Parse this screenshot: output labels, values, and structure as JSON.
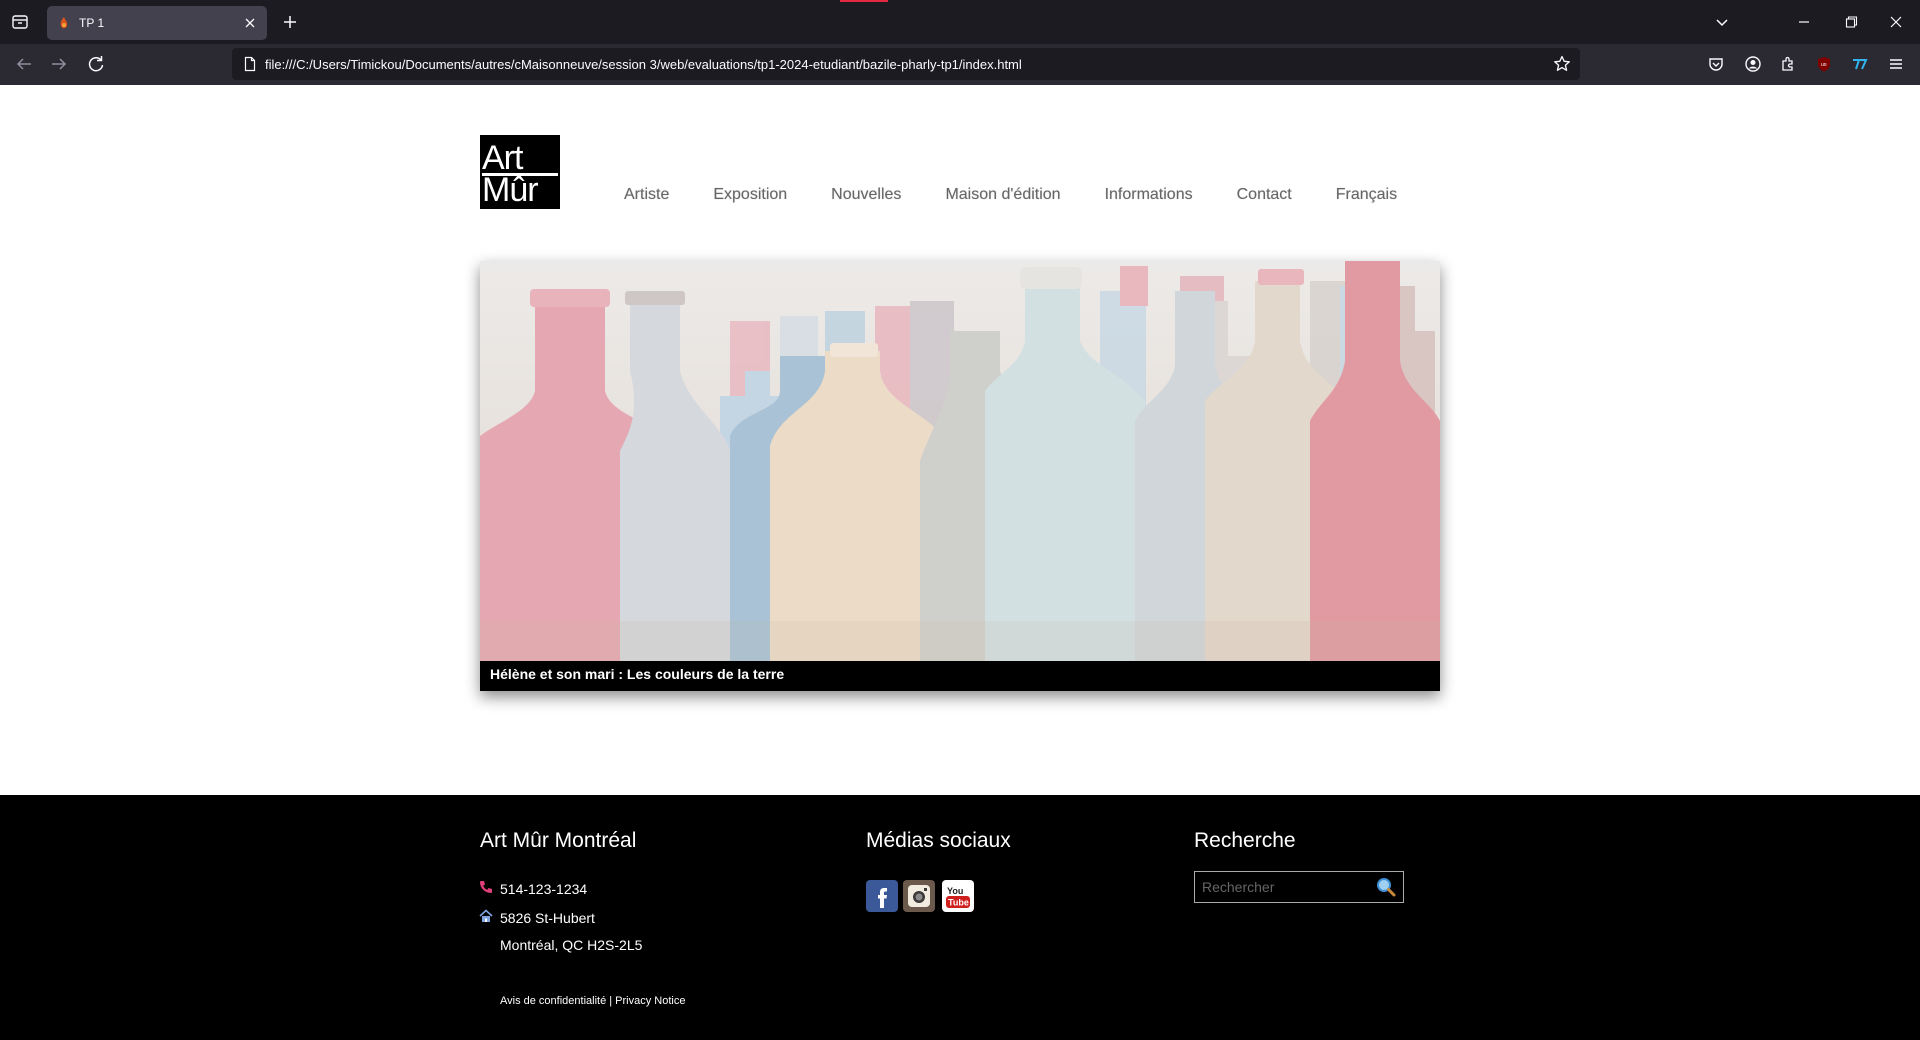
{
  "browser": {
    "tab_title": "TP 1",
    "url": "file:///C:/Users/Timickou/Documents/autres/cMaisonneuve/session 3/web/evaluations/tp1-2024-etudiant/bazile-pharly-tp1/index.html"
  },
  "logo": {
    "line1": "Art",
    "line2": "Mûr"
  },
  "nav": {
    "items": [
      "Artiste",
      "Exposition",
      "Nouvelles",
      "Maison d'édition",
      "Informations",
      "Contact",
      "Français"
    ]
  },
  "hero": {
    "caption": "Hélène et son mari : Les couleurs de la terre"
  },
  "footer": {
    "col1": {
      "title": "Art Mûr Montréal",
      "phone": "514-123-1234",
      "address1": "5826 St-Hubert",
      "address2": "Montréal, QC H2S-2L5",
      "privacy": "Avis de confidentialité | Privacy Notice"
    },
    "col2": {
      "title": "Médias sociaux",
      "icons": [
        "facebook-icon",
        "instagram-icon",
        "youtube-icon"
      ]
    },
    "col3": {
      "title": "Recherche",
      "placeholder": "Rechercher"
    }
  },
  "colors": {
    "footer_bg": "#000000",
    "chrome_bg": "#1c1b22",
    "phone_icon": "#e0407a",
    "nav_text": "#666666"
  }
}
